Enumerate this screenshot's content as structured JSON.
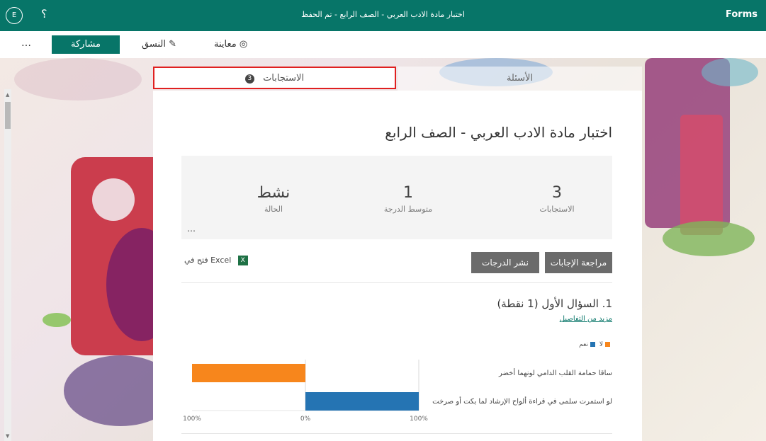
{
  "topbar": {
    "avatar_letter": "E",
    "help_glyph": "؟",
    "doc_title": "اختبار مادة الادب العربي - الصف الرابع - تم الحفظ",
    "brand": "Forms"
  },
  "cmdbar": {
    "more_glyph": "…",
    "share_label": "مشاركة",
    "theme_label": "النسق",
    "preview_label": "معاينة"
  },
  "tabs": {
    "responses_label": "الاستجابات",
    "responses_count": "3",
    "questions_label": "الأسئلة"
  },
  "form": {
    "title": "اختبار مادة الادب العربي - الصف الرابع"
  },
  "summary": {
    "responses_value": "3",
    "responses_label": "الاستجابات",
    "avg_value": "1",
    "avg_label": "متوسط الدرجة",
    "status_value": "نشط",
    "status_label": "الحالة",
    "more_glyph": "…"
  },
  "actions": {
    "review_label": "مراجعة الإجابات",
    "post_label": "نشر الدرجات",
    "excel_label": "فتح في Excel"
  },
  "question": {
    "title": "1.  السؤال الأول (1 نقطة)",
    "more_details": "مزيد من التفاصيل"
  },
  "chart_data": {
    "type": "bar",
    "orientation": "horizontal",
    "categories": [
      "ساقا حمامة القلب الدامي لونهما أخضر",
      "لو استمرت سلمى في قراءة ألواح الإرشاد لما بكت أو صرخت"
    ],
    "series": [
      {
        "name": "لا",
        "color": "#f7861c",
        "values": [
          100,
          0
        ]
      },
      {
        "name": "نعم",
        "color": "#2574b3",
        "values": [
          0,
          100
        ]
      }
    ],
    "x_ticks": [
      "100%",
      "0%",
      "100%"
    ],
    "xlim": [
      -100,
      100
    ],
    "legend_position": "top-right"
  },
  "colors": {
    "brand": "#077568",
    "button_gray": "#6b6b6b",
    "tab_highlight": "#e02020"
  }
}
